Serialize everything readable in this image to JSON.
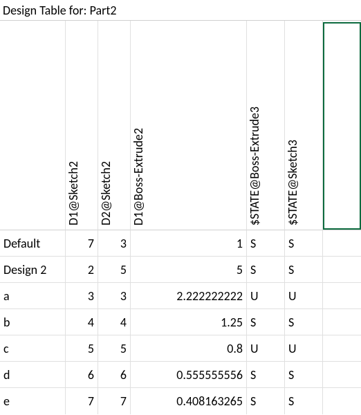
{
  "title": "Design Table for: Part2",
  "headers": {
    "c0": "",
    "c1": "D1@Sketch2",
    "c2": "D2@Sketch2",
    "c3": "D1@Boss-Extrude2",
    "c4": "$STATE@Boss-Extrude3",
    "c5": "$STATE@Sketch3"
  },
  "rows": [
    {
      "label": "Default",
      "c1": "7",
      "c2": "3",
      "c3": "1",
      "c4": "S",
      "c5": "S"
    },
    {
      "label": "Design 2",
      "c1": "2",
      "c2": "5",
      "c3": "5",
      "c4": "S",
      "c5": "S"
    },
    {
      "label": "a",
      "c1": "3",
      "c2": "3",
      "c3": "2.222222222",
      "c4": "U",
      "c5": "U"
    },
    {
      "label": "b",
      "c1": "4",
      "c2": "4",
      "c3": "1.25",
      "c4": "S",
      "c5": "S"
    },
    {
      "label": "c",
      "c1": "5",
      "c2": "5",
      "c3": "0.8",
      "c4": "U",
      "c5": "U"
    },
    {
      "label": "d",
      "c1": "6",
      "c2": "6",
      "c3": "0.555555556",
      "c4": "S",
      "c5": "S"
    },
    {
      "label": "e",
      "c1": "7",
      "c2": "7",
      "c3": "0.408163265",
      "c4": "S",
      "c5": "S"
    }
  ]
}
